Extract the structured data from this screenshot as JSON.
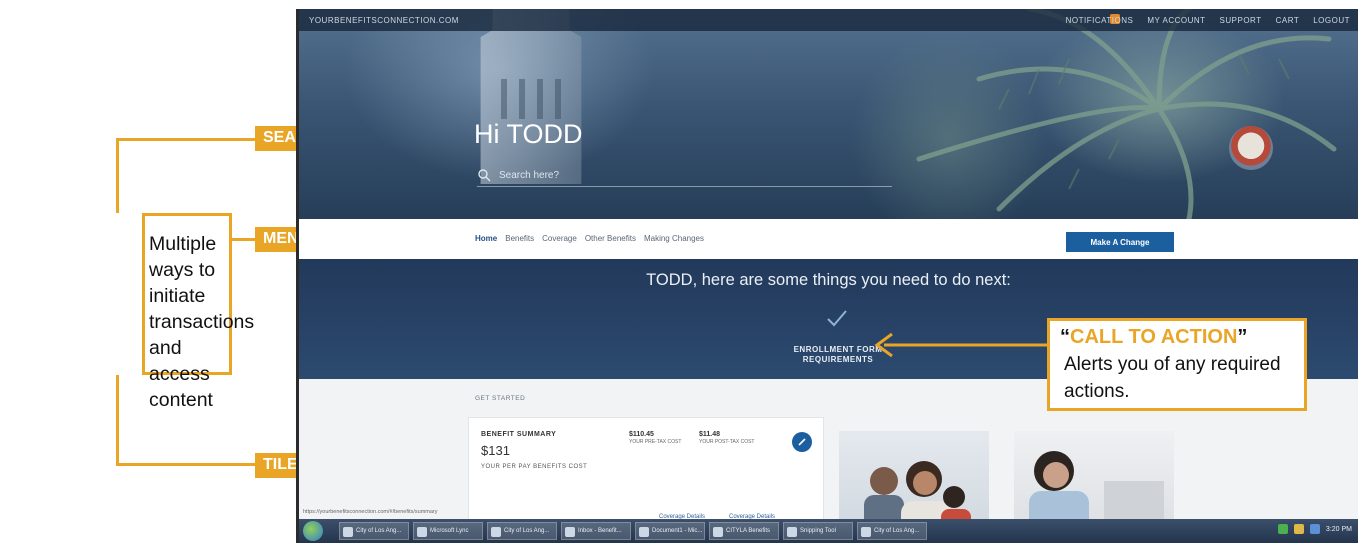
{
  "annotations": {
    "left_box_text": "Multiple ways to initiate transactions and access content",
    "tag_search": "SEARCH",
    "tag_menu": "MENU",
    "tag_tiles": "TILES",
    "cta_title_highlight": "CALL TO ACTION",
    "cta_body": "Alerts you of any required actions.",
    "accent_color": "#e9a526"
  },
  "browser": {
    "topbar": {
      "site_name": "YOURBENEFITSCONNECTION.COM",
      "links": [
        "NOTIFICATIONS",
        "MY ACCOUNT",
        "SUPPORT",
        "CART",
        "LOGOUT"
      ]
    },
    "hero": {
      "greeting": "Hi TODD",
      "search_placeholder": "Search here?"
    },
    "menu": {
      "items": [
        "Home",
        "Benefits",
        "Coverage",
        "Other Benefits",
        "Making Changes"
      ],
      "cta_button": "Make A Change"
    },
    "next_steps": {
      "heading": "TODD, here are some things you need to do next:",
      "item_label": "ENROLLMENT FORM REQUIREMENTS"
    },
    "tiles": {
      "section_label": "GET STARTED",
      "benefit_summary": {
        "title": "BENEFIT SUMMARY",
        "amount": "$131",
        "subtitle": "YOUR PER PAY BENEFITS COST",
        "stat_a_value": "$110.45",
        "stat_a_label": "YOUR PRE-TAX COST",
        "stat_b_value": "$11.48",
        "stat_b_label": "YOUR POST-TAX COST",
        "link_a": "Coverage Details",
        "link_b": "Coverage Details"
      }
    },
    "status_url": "https://yourbenefitsconnection.com/#/benefits/summary",
    "taskbar": {
      "items": [
        "City of Los Ang...",
        "Microsoft Lync",
        "City of Los Ang...",
        "Inbox - Benefit...",
        "Document1 - Mic...",
        "CITYLA Benefits",
        "Snipping Tool",
        "City of Los Ang..."
      ],
      "clock": "3:20 PM"
    }
  }
}
